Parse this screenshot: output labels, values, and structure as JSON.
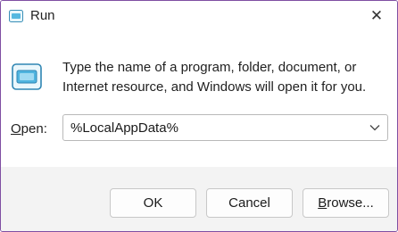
{
  "window": {
    "title": "Run",
    "close_glyph": "✕",
    "title_icon": "run-icon",
    "frame_color": "#7f4fa3"
  },
  "main": {
    "app_icon": "run-app-icon",
    "description_line1": "Type the name of a program, folder, document, or",
    "description_line2": "Internet resource, and Windows will open it for you.",
    "open_label_mnemonic": "O",
    "open_label_rest": "pen:",
    "open_value": "%LocalAppData%",
    "dropdown_icon": "chevron-down-icon"
  },
  "buttons": {
    "ok_label": "OK",
    "cancel_label": "Cancel",
    "browse_mnemonic": "B",
    "browse_rest": "rowse..."
  }
}
